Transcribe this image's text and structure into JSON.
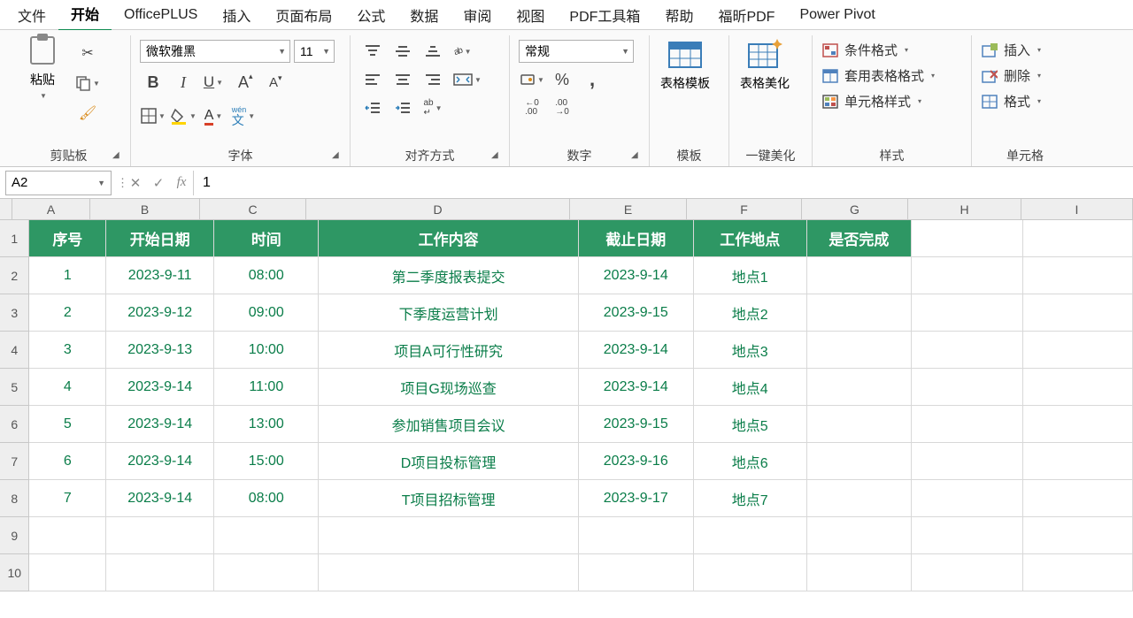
{
  "menu": {
    "items": [
      "文件",
      "开始",
      "OfficePLUS",
      "插入",
      "页面布局",
      "公式",
      "数据",
      "审阅",
      "视图",
      "PDF工具箱",
      "帮助",
      "福昕PDF",
      "Power Pivot"
    ],
    "active_index": 1
  },
  "ribbon": {
    "clipboard": {
      "paste": "粘贴",
      "label": "剪贴板"
    },
    "font": {
      "name": "微软雅黑",
      "size": "11",
      "label": "字体",
      "bold": "B",
      "italic": "I",
      "underline": "U",
      "phonetic_top": "wén",
      "phonetic_bottom": "文"
    },
    "align": {
      "label": "对齐方式"
    },
    "number": {
      "format": "常规",
      "label": "数字"
    },
    "template": {
      "btn": "表格模板",
      "label": "模板"
    },
    "beautify": {
      "btn": "表格美化",
      "label": "一键美化"
    },
    "styles": {
      "cond": "条件格式",
      "table": "套用表格格式",
      "cell": "单元格样式",
      "label": "样式"
    },
    "cells": {
      "insert": "插入",
      "delete": "删除",
      "format": "格式",
      "label": "单元格"
    }
  },
  "namebox": "A2",
  "formula": "1",
  "columns": [
    "A",
    "B",
    "C",
    "D",
    "E",
    "F",
    "G",
    "H",
    "I"
  ],
  "row_numbers": [
    "1",
    "2",
    "3",
    "4",
    "5",
    "6",
    "7",
    "8",
    "9",
    "10"
  ],
  "header_row": [
    "序号",
    "开始日期",
    "时间",
    "工作内容",
    "截止日期",
    "工作地点",
    "是否完成"
  ],
  "data_rows": [
    [
      "1",
      "2023-9-11",
      "08:00",
      "第二季度报表提交",
      "2023-9-14",
      "地点1",
      ""
    ],
    [
      "2",
      "2023-9-12",
      "09:00",
      "下季度运营计划",
      "2023-9-15",
      "地点2",
      ""
    ],
    [
      "3",
      "2023-9-13",
      "10:00",
      "项目A可行性研究",
      "2023-9-14",
      "地点3",
      ""
    ],
    [
      "4",
      "2023-9-14",
      "11:00",
      "项目G现场巡查",
      "2023-9-14",
      "地点4",
      ""
    ],
    [
      "5",
      "2023-9-14",
      "13:00",
      "参加销售项目会议",
      "2023-9-15",
      "地点5",
      ""
    ],
    [
      "6",
      "2023-9-14",
      "15:00",
      "D项目投标管理",
      "2023-9-16",
      "地点6",
      ""
    ],
    [
      "7",
      "2023-9-14",
      "08:00",
      "T项目招标管理",
      "2023-9-17",
      "地点7",
      ""
    ]
  ]
}
